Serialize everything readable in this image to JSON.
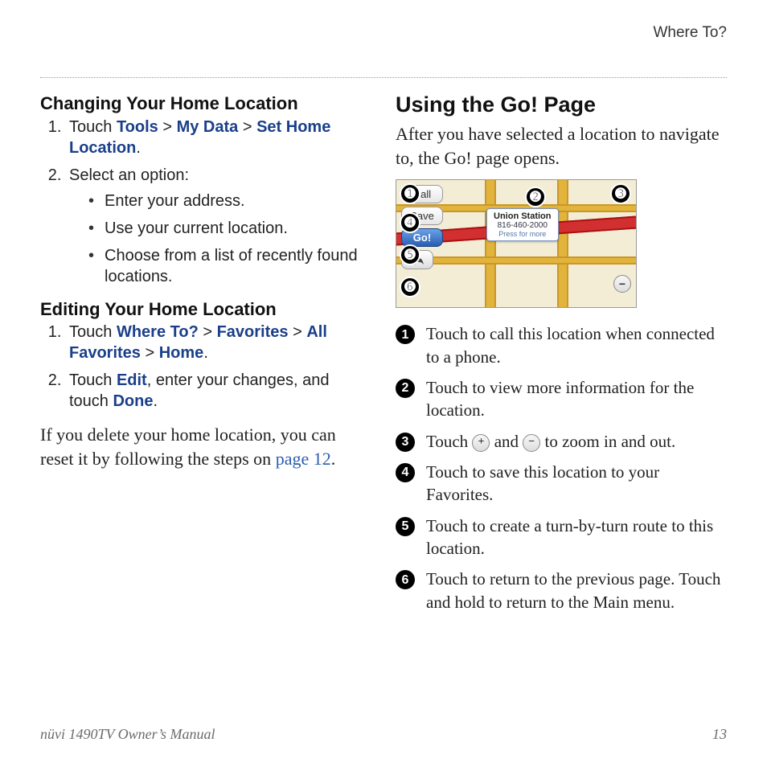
{
  "chapter": "Where To?",
  "left": {
    "h1": "Changing Your Home Location",
    "s1_prefix": "Touch ",
    "s1_links": [
      "Tools",
      "My Data",
      "Set Home Location"
    ],
    "s2": "Select an option:",
    "bullets": [
      "Enter your address.",
      "Use your current location.",
      "Choose from a list of recently found locations."
    ],
    "h2": "Editing Your Home Location",
    "e1_prefix": "Touch ",
    "e1_links": [
      "Where To?",
      "Favorites",
      "All Favorites",
      "Home"
    ],
    "e2_a": "Touch ",
    "e2_edit": "Edit",
    "e2_b": ", enter your changes, and touch ",
    "e2_done": "Done",
    "e2_c": ".",
    "para_a": "If you delete your home location, you can reset it by following the steps on ",
    "para_link": "page 12",
    "para_b": "."
  },
  "right": {
    "h1": "Using the Go! Page",
    "intro": "After you have selected a location to navigate to, the Go! page opens.",
    "ui": {
      "call": "Call",
      "save": "Save",
      "go": "Go!",
      "balloon_title": "Union Station",
      "balloon_phone": "816-460-2000",
      "balloon_hint": "Press for more"
    },
    "callouts": [
      "Touch to call this location when connected to a phone.",
      "Touch to view more information for the location.",
      "Touch ⊕ and ⊖ to zoom in and out.",
      "Touch to save this location to your Favorites.",
      "Touch to create a turn-by-turn route to this location.",
      "Touch to return to the previous page. Touch and hold to return to the Main menu."
    ],
    "c3_a": "Touch ",
    "c3_b": " and ",
    "c3_c": " to zoom in and out."
  },
  "footer": {
    "left": "nüvi 1490TV Owner’s Manual",
    "right": "13"
  }
}
